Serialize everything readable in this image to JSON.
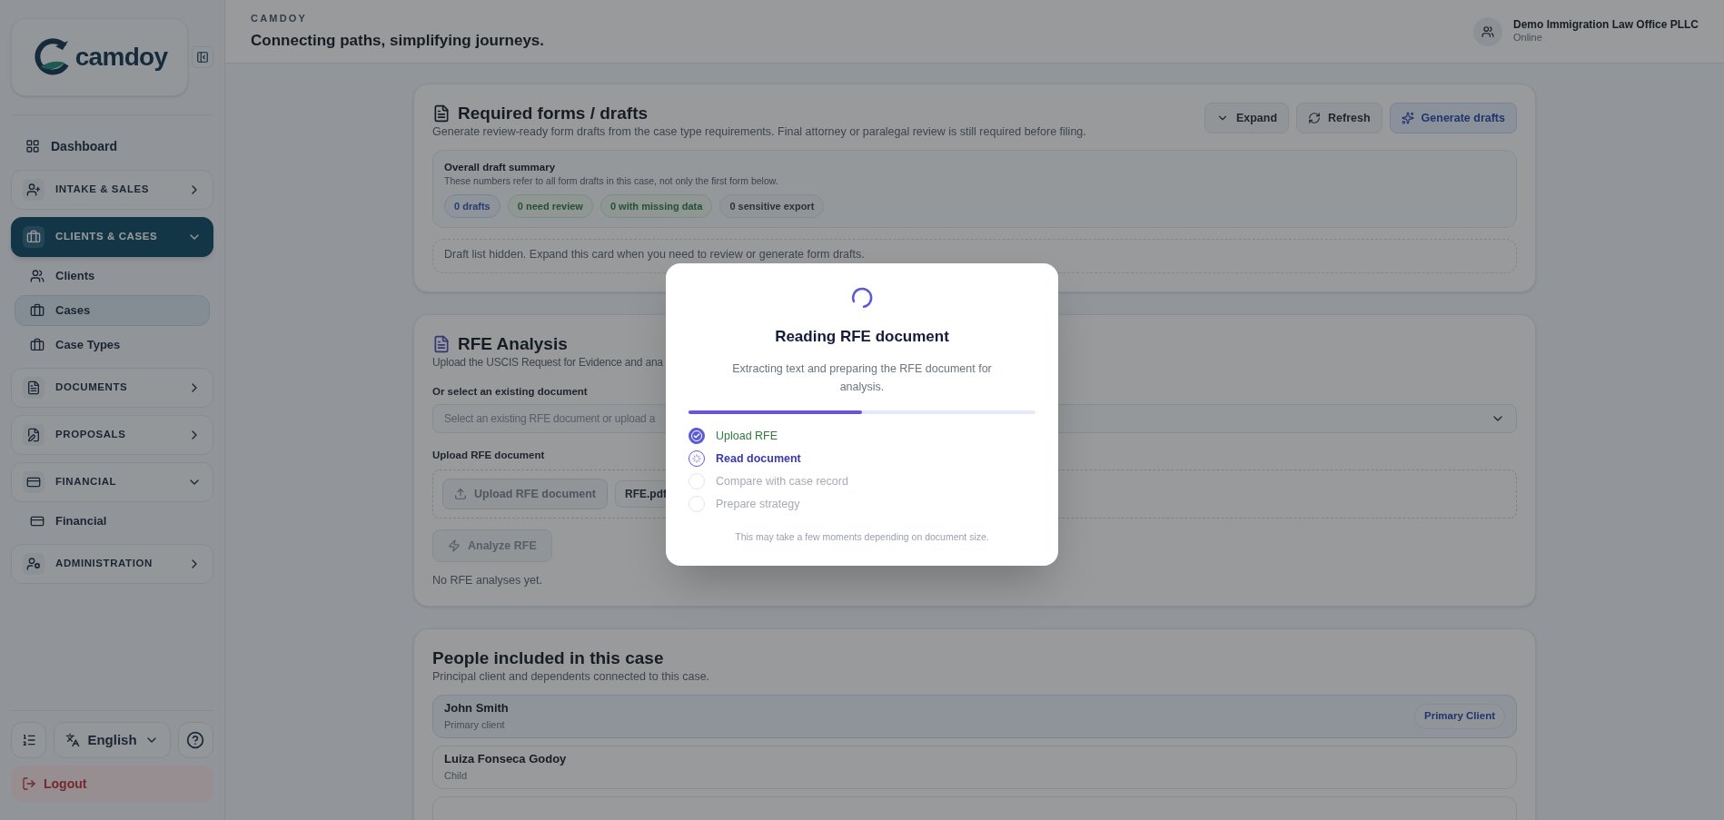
{
  "sidebar": {
    "logo_text": "camdoy",
    "items": [
      {
        "kind": "link",
        "label": "Dashboard",
        "selected": false
      },
      {
        "kind": "group",
        "label": "INTAKE & SALES",
        "selected": false,
        "expanded": false
      },
      {
        "kind": "group",
        "label": "CLIENTS & CASES",
        "selected": true,
        "expanded": true,
        "children": [
          {
            "label": "Clients",
            "selected": false
          },
          {
            "label": "Cases",
            "selected": true
          },
          {
            "label": "Case Types",
            "selected": false
          }
        ]
      },
      {
        "kind": "group",
        "label": "DOCUMENTS",
        "selected": false,
        "expanded": false
      },
      {
        "kind": "group",
        "label": "PROPOSALS",
        "selected": false,
        "expanded": false
      },
      {
        "kind": "group",
        "label": "FINANCIAL",
        "selected": false,
        "expanded": true,
        "children": [
          {
            "label": "Financial",
            "selected": false
          }
        ]
      },
      {
        "kind": "group",
        "label": "ADMINISTRATION",
        "selected": false,
        "expanded": false
      }
    ],
    "language": "English",
    "logout": "Logout"
  },
  "header": {
    "brand": "CAMDOY",
    "tagline": "Connecting paths, simplifying journeys.",
    "account": {
      "name": "Demo Immigration Law Office PLLC",
      "status": "Online"
    }
  },
  "forms_card": {
    "title": "Required forms / drafts",
    "description": "Generate review-ready form drafts from the case type requirements. Final attorney or paralegal review is still required before filing.",
    "buttons": [
      {
        "kind": "expand",
        "label": "Expand"
      },
      {
        "kind": "refresh",
        "label": "Refresh"
      },
      {
        "kind": "generate",
        "label": "Generate drafts"
      }
    ],
    "summary": {
      "title": "Overall draft summary",
      "note": "These numbers refer to all form drafts in this case, not only the first form below.",
      "badges": [
        {
          "label": "0 drafts",
          "kind": "info"
        },
        {
          "label": "0 need review",
          "kind": "success"
        },
        {
          "label": "0 with missing data",
          "kind": "success"
        },
        {
          "label": "0 sensitive export",
          "kind": "neutral"
        }
      ]
    },
    "hidden_note": "Draft list hidden. Expand this card when you need to review or generate form drafts."
  },
  "rfe_card": {
    "title": "RFE Analysis",
    "description": "Upload the USCIS Request for Evidence and ana",
    "select_label": "Or select an existing document",
    "select_placeholder": "Select an existing RFE document or upload a",
    "upload_label": "Upload RFE document",
    "upload_button": "Upload RFE document",
    "file_name": "RFE.pdf",
    "analyze_button": "Analyze RFE",
    "empty": "No RFE analyses yet."
  },
  "people_card": {
    "title": "People included in this case",
    "description": "Principal client and dependents connected to this case.",
    "people": [
      {
        "name": "John Smith",
        "role": "Primary client",
        "badge": "Primary Client",
        "selected": true
      },
      {
        "name": "Luiza Fonseca Godoy",
        "role": "Child",
        "selected": false
      }
    ]
  },
  "modal": {
    "title": "Reading RFE document",
    "description": "Extracting text and preparing the RFE document for analysis.",
    "level": 0.5,
    "steps": [
      {
        "label": "Upload RFE",
        "kind": "done"
      },
      {
        "label": "Read document",
        "kind": "active"
      },
      {
        "label": "Compare with case record",
        "kind": "pending"
      },
      {
        "label": "Prepare strategy",
        "kind": "pending"
      }
    ],
    "note": "This may take a few moments depending on document size."
  }
}
